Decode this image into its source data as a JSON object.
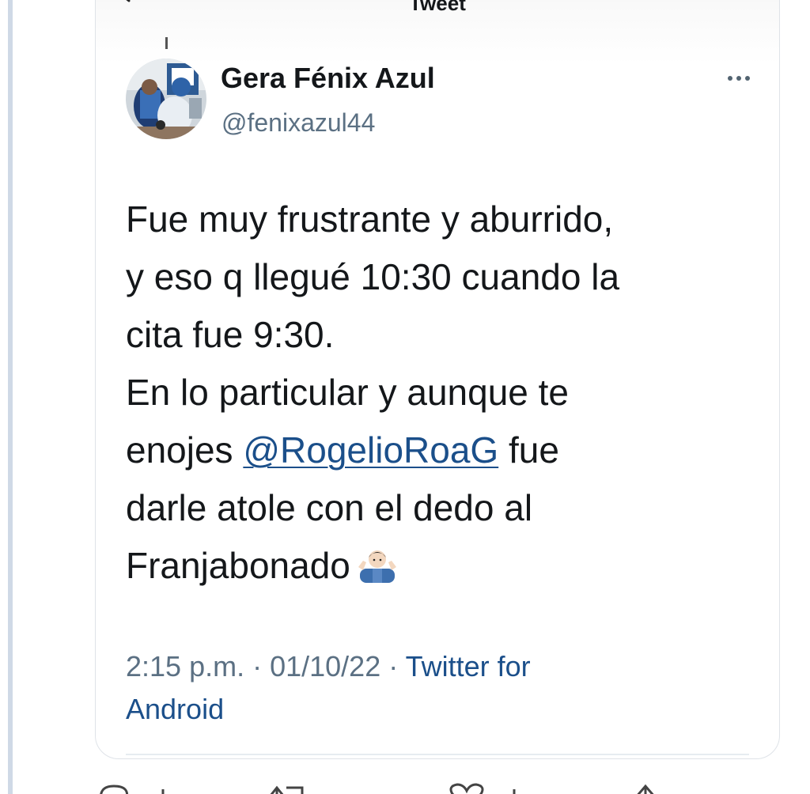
{
  "header": {
    "title": "Tweet"
  },
  "tweet": {
    "author": {
      "display_name": "Gera Fénix Azul",
      "handle": "@fenixazul44"
    },
    "text_lines": {
      "l1": "Fue muy frustrante y aburrido,",
      "l2": "y eso q llegué 10:30 cuando la",
      "l3": "cita fue 9:30.",
      "l4": "En lo particular y aunque te",
      "l5_pre": "enojes ",
      "l5_mention": "@RogelioRoaG",
      "l5_post": " fue",
      "l6": "darle atole con el dedo al",
      "l7": "Franjabonado"
    },
    "emoji": "man-shrugging",
    "meta": {
      "time": "2:15 p.m.",
      "sep1": " · ",
      "date": "01/10/22",
      "sep2": " · ",
      "source_part1": "Twitter for",
      "source_part2": "Android"
    }
  },
  "icons": {
    "back": "arrow-left-icon",
    "more": "more-horizontal-icon",
    "actions": [
      "reply-icon",
      "retweet-icon",
      "like-icon",
      "share-icon"
    ]
  },
  "colors": {
    "link": "#1b4f8a",
    "text": "#14171a",
    "secondary": "#5b7083",
    "left_rule": "#cfd9e6"
  }
}
